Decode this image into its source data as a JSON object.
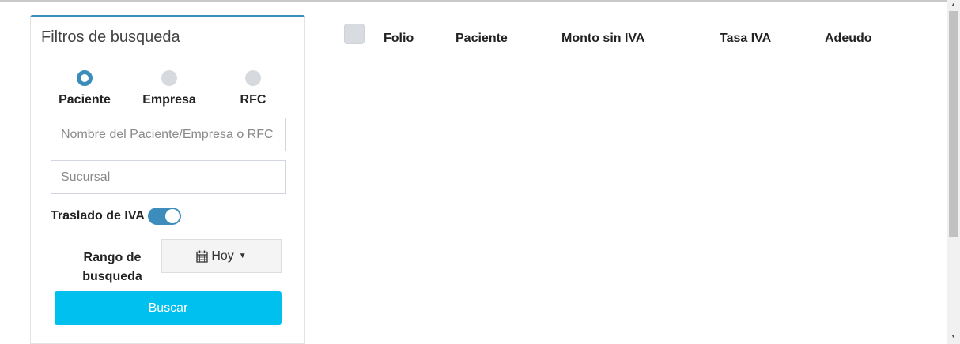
{
  "filters": {
    "title": "Filtros de busqueda",
    "radio_options": [
      {
        "label": "Paciente",
        "checked": true
      },
      {
        "label": "Empresa",
        "checked": false
      },
      {
        "label": "RFC",
        "checked": false
      }
    ],
    "search_placeholder": "Nombre del Paciente/Empresa o RFC",
    "branch_placeholder": "Sucursal",
    "toggle_label": "Traslado de IVA",
    "toggle_on": true,
    "range_label": "Rango de busqueda",
    "range_value": "Hoy",
    "search_button": "Buscar"
  },
  "table": {
    "columns": [
      "Folio",
      "Paciente",
      "Monto sin IVA",
      "Tasa IVA",
      "Adeudo"
    ],
    "rows": []
  },
  "colors": {
    "accent": "#3c8dbc",
    "button": "#00c0ef"
  },
  "icons": {
    "range_icon": "calendar-icon",
    "range_caret": "caret-down-icon"
  }
}
